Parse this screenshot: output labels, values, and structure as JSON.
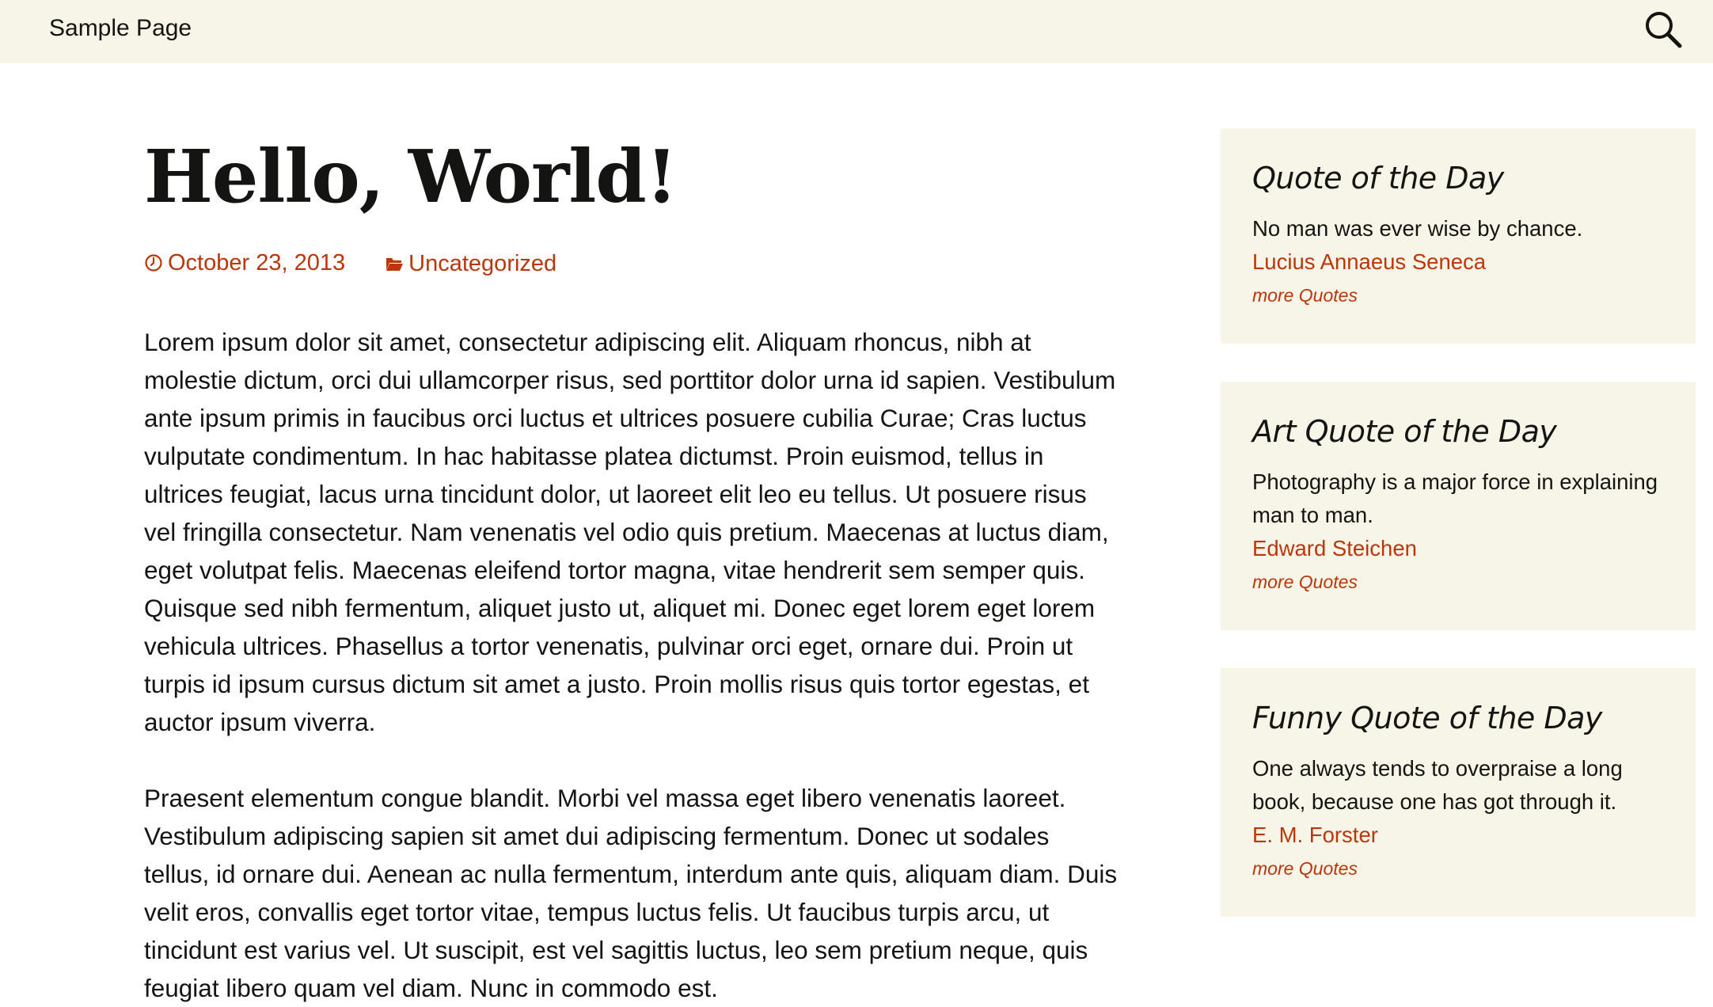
{
  "header": {
    "nav_label": "Sample Page",
    "search_icon": "search-icon"
  },
  "post": {
    "title": "Hello, World!",
    "date": "October 23, 2013",
    "category": "Uncategorized",
    "paragraphs": [
      "Lorem ipsum dolor sit amet, consectetur adipiscing elit. Aliquam rhoncus, nibh at molestie dictum, orci dui ullamcorper risus, sed porttitor dolor urna id sapien. Vestibulum ante ipsum primis in faucibus orci luctus et ultrices posuere cubilia Curae; Cras luctus vulputate condimentum. In hac habitasse platea dictumst. Proin euismod, tellus in ultrices feugiat, lacus urna tincidunt dolor, ut laoreet elit leo eu tellus. Ut posuere risus vel fringilla consectetur. Nam venenatis vel odio quis pretium. Maecenas at luctus diam, eget volutpat felis. Maecenas eleifend tortor magna, vitae hendrerit sem semper quis. Quisque sed nibh fermentum, aliquet justo ut, aliquet mi. Donec eget lorem eget lorem vehicula ultrices. Phasellus a tortor venenatis, pulvinar orci eget, ornare dui. Proin ut turpis id ipsum cursus dictum sit amet a justo. Proin mollis risus quis tortor egestas, et auctor ipsum viverra.",
      "Praesent elementum congue blandit. Morbi vel massa eget libero venenatis laoreet. Vestibulum adipiscing sapien sit amet dui adipiscing fermentum. Donec ut sodales tellus, id ornare dui. Aenean ac nulla fermentum, interdum ante quis, aliquam diam. Duis velit eros, convallis eget tortor vitae, tempus luctus felis. Ut faucibus turpis arcu, ut tincidunt est varius vel. Ut suscipit, est vel sagittis luctus, leo sem pretium neque, quis feugiat libero quam vel diam. Nunc in commodo est."
    ]
  },
  "sidebar": {
    "widgets": [
      {
        "title": "Quote of the Day",
        "quote": "No man was ever wise by chance.",
        "author": "Lucius Annaeus Seneca",
        "more": "more Quotes"
      },
      {
        "title": "Art Quote of the Day",
        "quote": "Photography is a major force in explaining man to man.",
        "author": "Edward Steichen",
        "more": "more Quotes"
      },
      {
        "title": "Funny Quote of the Day",
        "quote": "One always tends to overpraise a long book, because one has got through it.",
        "author": "E. M. Forster",
        "more": "more Quotes"
      }
    ]
  },
  "colors": {
    "accent": "#bc360a",
    "header_bg": "#f7f5e7",
    "widget_bg": "#f7f5e7",
    "text": "#141412"
  }
}
